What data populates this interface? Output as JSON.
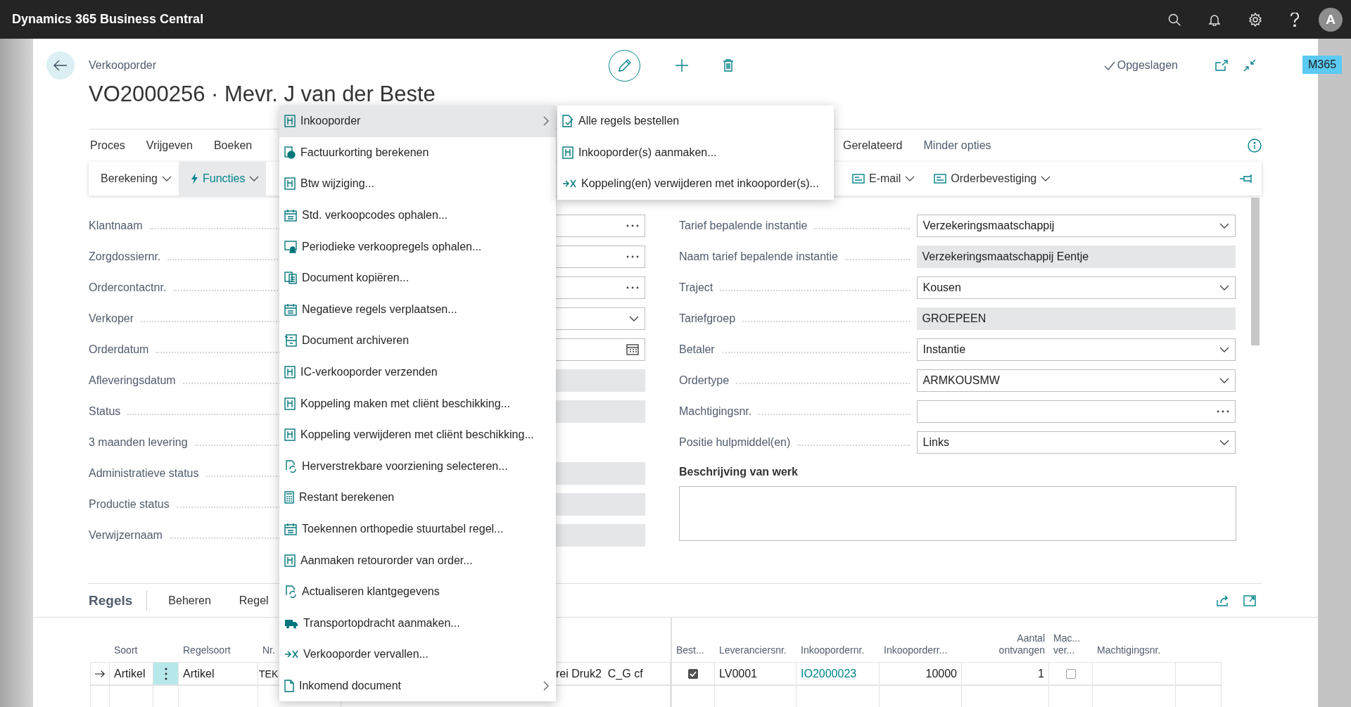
{
  "app_bar": {
    "title": "Dynamics 365 Business Central",
    "avatar": "A"
  },
  "environment_badge": "M365",
  "header": {
    "caption": "Verkooporder",
    "title": "VO2000256 · Mevr. J van der Beste",
    "save_status": "Opgeslagen"
  },
  "action_tabs": {
    "left": [
      "Proces",
      "Vrijgeven",
      "Boeken"
    ],
    "right": [
      "Gerelateerd",
      "Minder opties"
    ]
  },
  "toolbar": {
    "left": [
      {
        "label": "Berekening",
        "selected": false
      },
      {
        "label": "Functies",
        "selected": true
      }
    ],
    "right": [
      {
        "label": "E-mail",
        "selected": false
      },
      {
        "label": "Orderbevestiging",
        "selected": false
      }
    ]
  },
  "form": {
    "left": [
      {
        "label": "Klantnaam",
        "kind": "lookup"
      },
      {
        "label": "Zorgdossiernr.",
        "kind": "lookup"
      },
      {
        "label": "Ordercontactnr.",
        "kind": "lookup"
      },
      {
        "label": "Verkoper",
        "kind": "dropdown"
      },
      {
        "label": "Orderdatum",
        "kind": "date"
      },
      {
        "label": "Afleveringsdatum",
        "kind": "readonly"
      },
      {
        "label": "Status",
        "kind": "readonly"
      },
      {
        "label": "3 maanden levering",
        "kind": "blank"
      },
      {
        "label": "Administratieve status",
        "kind": "readonly"
      },
      {
        "label": "Productie status",
        "kind": "readonly"
      },
      {
        "label": "Verwijzernaam",
        "kind": "readonly"
      }
    ],
    "right": [
      {
        "label": "Tarief bepalende instantie",
        "kind": "dropdown",
        "value": "Verzekeringsmaatschappij"
      },
      {
        "label": "Naam tarief bepalende instantie",
        "kind": "readonly",
        "value": "Verzekeringsmaatschappij Eentje"
      },
      {
        "label": "Traject",
        "kind": "dropdown",
        "value": "Kousen"
      },
      {
        "label": "Tariefgroep",
        "kind": "readonly",
        "value": "GROEPEEN"
      },
      {
        "label": "Betaler",
        "kind": "dropdown",
        "value": "Instantie"
      },
      {
        "label": "Ordertype",
        "kind": "dropdown",
        "value": "ARMKOUSMW"
      },
      {
        "label": "Machtigingsnr.",
        "kind": "lookup"
      },
      {
        "label": "Positie hulpmiddel(en)",
        "kind": "dropdown",
        "value": "Links"
      }
    ],
    "description_label": "Beschrijving van werk"
  },
  "lines": {
    "title": "Regels",
    "tabs": [
      "Beheren",
      "Regel"
    ],
    "columns": [
      "Soort",
      "Regelsoort",
      "Nr.",
      "Best...",
      "Leveranciersnr.",
      "Inkoopordernr.",
      "Inkooporderr...",
      "Aantal\nontvangen",
      "Mac...\nver...",
      "Machtigingsnr."
    ],
    "rows": [
      {
        "selected": true,
        "soort": "Artikel",
        "regelsoort": "Artikel",
        "nr": "TEK",
        "description": "rei Druk2  C_G cf",
        "ordered": true,
        "vendor_no": "LV0001",
        "purchase_order_no": "IO2000023",
        "purchase_order_line": "10000",
        "qty_received": "1",
        "authorization_checked": false
      }
    ]
  },
  "menu": {
    "items": [
      {
        "label": "Inkooporder",
        "selected": true,
        "submenu": true
      },
      {
        "label": "Factuurkorting berekenen",
        "selected": false,
        "submenu": false
      },
      {
        "label": "Btw wijziging...",
        "selected": false,
        "submenu": false
      },
      {
        "label": "Std. verkoopcodes ophalen...",
        "selected": false,
        "submenu": false
      },
      {
        "label": "Periodieke verkoopregels ophalen...",
        "selected": false,
        "submenu": false
      },
      {
        "label": "Document kopiëren...",
        "selected": false,
        "submenu": false
      },
      {
        "label": "Negatieve regels verplaatsen...",
        "selected": false,
        "submenu": false
      },
      {
        "label": "Document archiveren",
        "selected": false,
        "submenu": false
      },
      {
        "label": "IC-verkooporder verzenden",
        "selected": false,
        "submenu": false
      },
      {
        "label": "Koppeling maken met cliënt beschikking...",
        "selected": false,
        "submenu": false
      },
      {
        "label": "Koppeling verwijderen met cliënt beschikking...",
        "selected": false,
        "submenu": false
      },
      {
        "label": "Herverstrekbare voorziening selecteren...",
        "selected": false,
        "submenu": false
      },
      {
        "label": "Restant berekenen",
        "selected": false,
        "submenu": false
      },
      {
        "label": "Toekennen orthopedie stuurtabel regel...",
        "selected": false,
        "submenu": false
      },
      {
        "label": "Aanmaken retourorder van order...",
        "selected": false,
        "submenu": false
      },
      {
        "label": "Actualiseren klantgegevens",
        "selected": false,
        "submenu": false
      },
      {
        "label": "Transportopdracht aanmaken...",
        "selected": false,
        "submenu": false
      },
      {
        "label": "Verkooporder vervallen...",
        "selected": false,
        "submenu": false
      },
      {
        "label": "Inkomend document",
        "selected": false,
        "submenu": true
      }
    ]
  },
  "submenu": {
    "items": [
      {
        "label": "Alle regels bestellen",
        "selected": false
      },
      {
        "label": "Inkooporder(s) aanmaken...",
        "selected": false
      },
      {
        "label": "Koppeling(en) verwijderen met inkooporder(s)...",
        "selected": false
      }
    ]
  }
}
